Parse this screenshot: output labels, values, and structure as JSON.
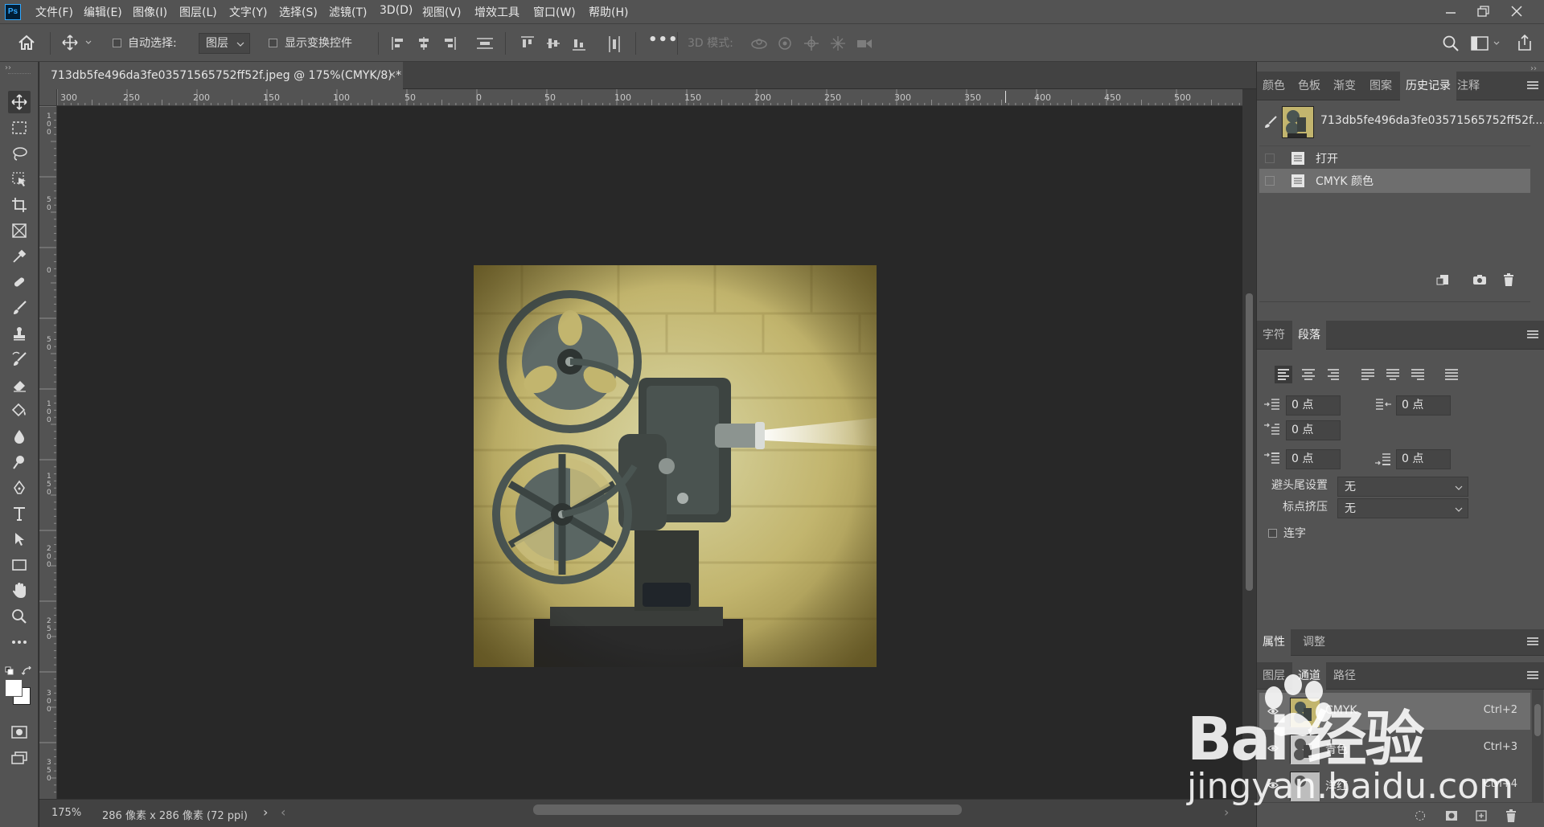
{
  "app": {
    "logo": "Ps",
    "menu": [
      "文件(F)",
      "编辑(E)",
      "图像(I)",
      "图层(L)",
      "文字(Y)",
      "选择(S)",
      "滤镜(T)",
      "3D(D)",
      "视图(V)",
      "增效工具",
      "窗口(W)",
      "帮助(H)"
    ],
    "window_controls": [
      "minimize",
      "restore",
      "close"
    ]
  },
  "options_bar": {
    "auto_select_label": "自动选择:",
    "auto_select_checked": false,
    "auto_select_target": "图层",
    "show_transform_label": "显示变换控件",
    "show_transform_checked": false,
    "more_label": "•••",
    "mode_3d_label": "3D 模式:"
  },
  "document": {
    "tab_title": "713db5fe496da3fe03571565752ff52f.jpeg @ 175%(CMYK/8) *",
    "close_glyph": "×"
  },
  "ruler": {
    "h_labels": [
      "300",
      "250",
      "200",
      "150",
      "100",
      "50",
      "0",
      "50",
      "100",
      "150",
      "200",
      "250",
      "300",
      "350",
      "400",
      "450",
      "500"
    ],
    "v_labels": [
      "1 0 0",
      "5 0",
      "0",
      "5 0",
      "1 0 0",
      "1 5 0",
      "2 0 0",
      "2 5 0",
      "3 0 0",
      "3 5 0"
    ]
  },
  "status": {
    "zoom": "175%",
    "doc_info": "286 像素 x 286 像素 (72 ppi)",
    "arrow": "›",
    "left_arrow": "‹",
    "right_arrow": "›"
  },
  "panels": {
    "top_tabs": [
      "颜色",
      "色板",
      "渐变",
      "图案",
      "历史记录",
      "注释"
    ],
    "top_active": "历史记录",
    "history": {
      "snapshot_name": "713db5fe496da3fe03571565752ff52f....",
      "items": [
        {
          "label": "打开",
          "selected": false
        },
        {
          "label": "CMYK 颜色",
          "selected": true
        }
      ]
    },
    "mid_tabs": [
      "字符",
      "段落"
    ],
    "mid_active": "段落",
    "paragraph": {
      "indent_left": "0 点",
      "indent_right": "0 点",
      "indent_first": "0 点",
      "space_before": "0 点",
      "space_after": "0 点",
      "kinsoku_label": "避头尾设置",
      "kinsoku_value": "无",
      "mojikumi_label": "标点挤压",
      "mojikumi_value": "无",
      "hyphenate_label": "连字",
      "hyphenate_checked": false
    },
    "props_tabs": [
      "属性",
      "调整"
    ],
    "props_active": "属性",
    "layer_tabs": [
      "图层",
      "通道",
      "路径"
    ],
    "layer_active": "通道",
    "channels": [
      {
        "name": "CMYK",
        "shortcut": "Ctrl+2"
      },
      {
        "name": "青色",
        "shortcut": "Ctrl+3"
      },
      {
        "name": "洋红",
        "shortcut": "Ctrl+4"
      }
    ]
  },
  "watermark": {
    "brand": "Bai 经验",
    "sub": "jingyan.baidu.com"
  },
  "colors": {
    "chrome": "#535353",
    "dark": "#424242",
    "canvas": "#282828",
    "selection": "#6e6e6e",
    "accent": "#31a8ff"
  }
}
